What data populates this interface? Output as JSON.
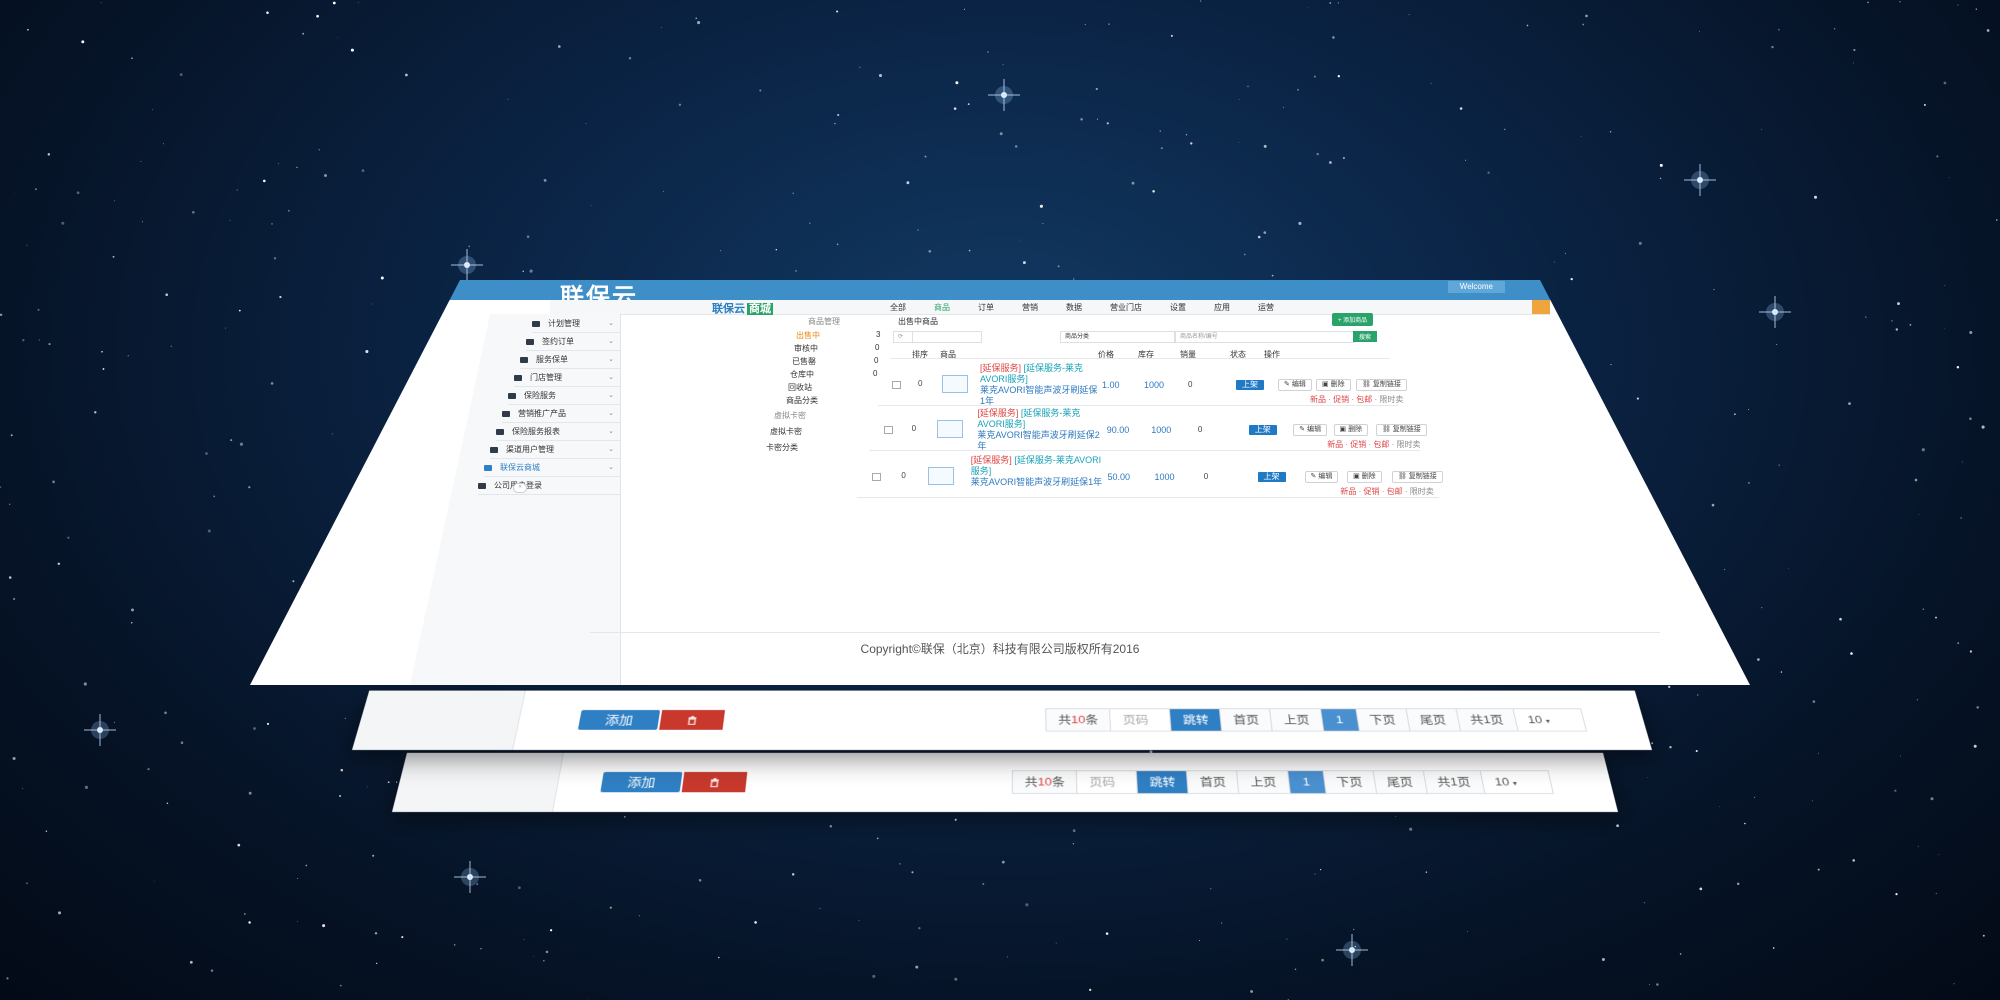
{
  "brand": "联保云",
  "welcome": "Welcome",
  "mall_logo": {
    "text": "联保云",
    "badge": "商城"
  },
  "nav": [
    "全部",
    "商品",
    "订单",
    "营销",
    "数据",
    "营业门店",
    "设置",
    "应用",
    "运营"
  ],
  "nav_active_index": 1,
  "nav_right": "",
  "sidebar": {
    "items": [
      {
        "label": "计划管理",
        "icon": "calendar-icon"
      },
      {
        "label": "签约订单",
        "icon": "order-icon"
      },
      {
        "label": "服务保单",
        "icon": "policy-icon"
      },
      {
        "label": "门店管理",
        "icon": "store-icon"
      },
      {
        "label": "保险服务",
        "icon": "service-icon"
      },
      {
        "label": "营销推广产品",
        "icon": "promo-icon"
      },
      {
        "label": "保险服务报表",
        "icon": "report-icon"
      },
      {
        "label": "渠道用户管理",
        "icon": "users-icon"
      },
      {
        "label": "联保云商城",
        "icon": "mall-icon"
      },
      {
        "label": "公司用户登录",
        "icon": "login-icon"
      }
    ],
    "selected_index": 8
  },
  "subnav": {
    "group1_title": "商品管理",
    "items": [
      {
        "label": "出售中",
        "count": "3"
      },
      {
        "label": "审核中",
        "count": "0"
      },
      {
        "label": "已售罄",
        "count": "0"
      },
      {
        "label": "仓库中",
        "count": "0"
      },
      {
        "label": "回收站",
        "count": ""
      },
      {
        "label": "商品分类",
        "count": ""
      }
    ],
    "group2_title": "虚拟卡密",
    "group2_items": [
      "虚拟卡密",
      "卡密分类"
    ]
  },
  "content": {
    "title": "出售中商品",
    "add_button": "+ 添加商品",
    "filter_placeholder": "商品名称/编号",
    "category_select": "商品分类",
    "search_button": "搜索",
    "columns": [
      "排序",
      "商品",
      "价格",
      "库存",
      "销量",
      "状态",
      "操作"
    ],
    "rows": [
      {
        "sort": "0",
        "tag": "[延保服务]",
        "service": "[延保服务-莱克AVORI服务]",
        "name": "莱克AVORI智能声波牙刷延保1年",
        "price": "1.00",
        "stock": "1000",
        "sales": "0",
        "status": "上架"
      },
      {
        "sort": "0",
        "tag": "[延保服务]",
        "service": "[延保服务-莱克AVORI服务]",
        "name": "莱克AVORI智能声波牙刷延保2年",
        "price": "90.00",
        "stock": "1000",
        "sales": "0",
        "status": "上架"
      },
      {
        "sort": "0",
        "tag": "[延保服务]",
        "service": "[延保服务-莱克AVORI服务]",
        "name": "莱克AVORI智能声波牙刷延保1年",
        "price": "50.00",
        "stock": "1000",
        "sales": "0",
        "status": "上架"
      }
    ],
    "op_buttons": [
      "编辑",
      "删除",
      "复制链接"
    ],
    "row_links": [
      "新品",
      "促销",
      "包邮",
      "限时卖"
    ]
  },
  "footer": {
    "copyright": "Copyright©联保（北京）科技有限公司版权所有2016"
  },
  "pager": {
    "add": "添加",
    "total_prefix": "共",
    "total_count": "10",
    "total_suffix": "条",
    "page_placeholder": "页码",
    "jump": "跳转",
    "first": "首页",
    "prev": "上页",
    "current": "1",
    "next": "下页",
    "last": "尾页",
    "pages": "共1页",
    "page_size": "10"
  },
  "colors": {
    "accent": "#2f7fc4",
    "danger": "#c8382c",
    "green": "#2aa36b",
    "space": "#061428"
  }
}
